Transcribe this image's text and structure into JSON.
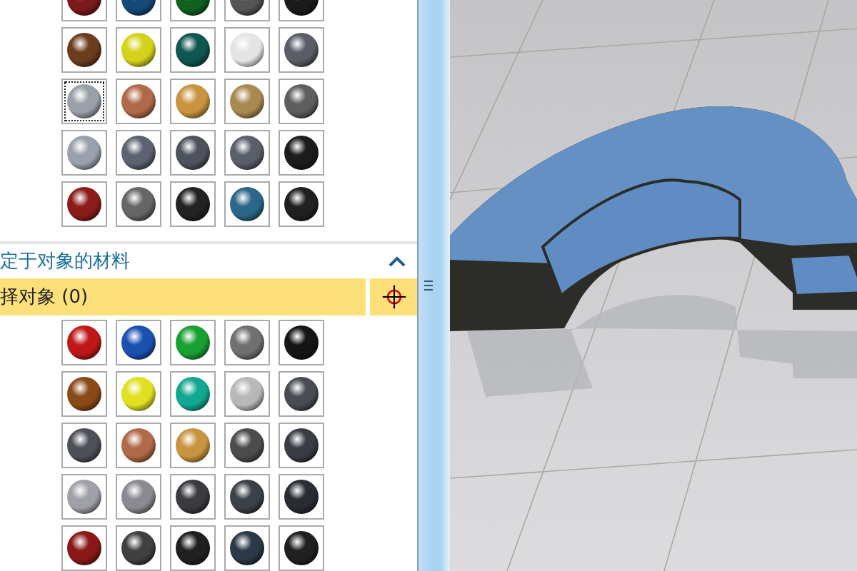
{
  "material_library": {
    "swatches": [
      {
        "color": "#7a1a1a",
        "selected": false
      },
      {
        "color": "#154a78",
        "selected": false
      },
      {
        "color": "#106020",
        "selected": false
      },
      {
        "color": "#555555",
        "selected": false
      },
      {
        "color": "#1a1a1a",
        "selected": false
      },
      {
        "color": "#6b3c1e",
        "selected": false
      },
      {
        "color": "#d4d21a",
        "selected": false
      },
      {
        "color": "#0f5550",
        "selected": false
      },
      {
        "color": "#e4e4e4",
        "selected": false
      },
      {
        "color": "#5a5c66",
        "selected": false
      },
      {
        "color": "#9aa0a8",
        "selected": true
      },
      {
        "color": "#b06a48",
        "selected": false
      },
      {
        "color": "#c89440",
        "selected": false
      },
      {
        "color": "#a88a50",
        "selected": false
      },
      {
        "color": "#5e5e5e",
        "selected": false
      },
      {
        "color": "#9aa0ac",
        "selected": false
      },
      {
        "color": "#5c6270",
        "selected": false
      },
      {
        "color": "#4e525c",
        "selected": false
      },
      {
        "color": "#5a5e68",
        "selected": false
      },
      {
        "color": "#1c1c1c",
        "selected": false
      },
      {
        "color": "#8c1c1c",
        "selected": false
      },
      {
        "color": "#666666",
        "selected": false
      },
      {
        "color": "#222222",
        "selected": false
      },
      {
        "color": "#2c6688",
        "selected": false
      },
      {
        "color": "#202020",
        "selected": false
      }
    ]
  },
  "object_materials": {
    "title": "定于对象的材料",
    "expanded": true,
    "select_object": {
      "label": "择对象 (0)"
    },
    "swatches": [
      {
        "color": "#c01818"
      },
      {
        "color": "#1a50b0"
      },
      {
        "color": "#18a030"
      },
      {
        "color": "#707070"
      },
      {
        "color": "#151515"
      },
      {
        "color": "#8a4a18"
      },
      {
        "color": "#e0e020"
      },
      {
        "color": "#10a890"
      },
      {
        "color": "#b8b8b8"
      },
      {
        "color": "#4a4c54"
      },
      {
        "color": "#4e5058"
      },
      {
        "color": "#b06a48"
      },
      {
        "color": "#c89440"
      },
      {
        "color": "#4c4c4c"
      },
      {
        "color": "#3a3c44"
      },
      {
        "color": "#a0a0a8"
      },
      {
        "color": "#8a8a90"
      },
      {
        "color": "#3a3a40"
      },
      {
        "color": "#3c4048"
      },
      {
        "color": "#2a2c34"
      },
      {
        "color": "#8a1818"
      },
      {
        "color": "#404040"
      },
      {
        "color": "#202020"
      },
      {
        "color": "#2a3848"
      },
      {
        "color": "#202020"
      }
    ]
  }
}
